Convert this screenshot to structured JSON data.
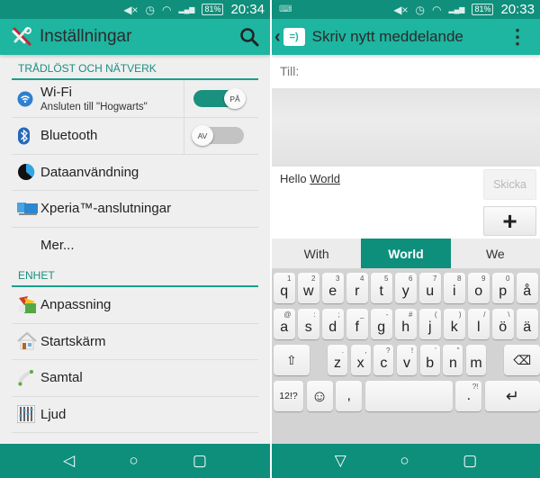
{
  "left": {
    "status": {
      "mute": "◀×",
      "alarm": "◷",
      "wifi": "◠",
      "signal": "▂▄▆",
      "battery": "81%",
      "time": "20:34"
    },
    "actionbar": {
      "icon": "wrench-screwdriver-icon",
      "title": "Inställningar",
      "search_icon": "⌕"
    },
    "sections": [
      {
        "header": "TRÅDLÖST OCH NÄTVERK",
        "items": [
          {
            "label": "Wi-Fi",
            "sub": "Ansluten till \"Hogwarts\"",
            "toggle": "PÅ",
            "toggle_on": true
          },
          {
            "label": "Bluetooth",
            "toggle": "AV",
            "toggle_on": false
          },
          {
            "label": "Dataanvändning"
          },
          {
            "label": "Xperia™-anslutningar"
          },
          {
            "label": "Mer..."
          }
        ]
      },
      {
        "header": "ENHET",
        "items": [
          {
            "label": "Anpassning"
          },
          {
            "label": "Startskärm"
          },
          {
            "label": "Samtal"
          },
          {
            "label": "Ljud"
          }
        ]
      }
    ],
    "nav": {
      "back": "◁",
      "home": "○",
      "recents": "▢"
    }
  },
  "right": {
    "status": {
      "keyboard_icon": "⌨",
      "mute": "◀×",
      "alarm": "◷",
      "wifi": "◠",
      "signal": "▂▄▆",
      "battery": "81%",
      "time": "20:33"
    },
    "actionbar": {
      "back": "‹",
      "app_icon": "=)",
      "title": "Skriv nytt meddelande",
      "menu": "⋮"
    },
    "to_label": "Till:",
    "message": {
      "before": "Hello ",
      "underlined": "World"
    },
    "send_label": "Skicka",
    "attach_label": "+",
    "suggestions": [
      {
        "text": "With",
        "active": false
      },
      {
        "text": "World",
        "active": true
      },
      {
        "text": "We",
        "active": false
      }
    ],
    "keyboard": {
      "row1": [
        {
          "k": "q",
          "a": "1"
        },
        {
          "k": "w",
          "a": "2"
        },
        {
          "k": "e",
          "a": "3"
        },
        {
          "k": "r",
          "a": "4"
        },
        {
          "k": "t",
          "a": "5"
        },
        {
          "k": "y",
          "a": "6"
        },
        {
          "k": "u",
          "a": "7"
        },
        {
          "k": "i",
          "a": "8"
        },
        {
          "k": "o",
          "a": "9"
        },
        {
          "k": "p",
          "a": "0"
        },
        {
          "k": "å",
          "a": ""
        }
      ],
      "row2": [
        {
          "k": "a",
          "a": "@"
        },
        {
          "k": "s",
          "a": ":"
        },
        {
          "k": "d",
          "a": ";"
        },
        {
          "k": "f",
          "a": "_"
        },
        {
          "k": "g",
          "a": "-"
        },
        {
          "k": "h",
          "a": "#"
        },
        {
          "k": "j",
          "a": "("
        },
        {
          "k": "k",
          "a": ")"
        },
        {
          "k": "l",
          "a": "/"
        },
        {
          "k": "ö",
          "a": "\\"
        },
        {
          "k": "ä",
          "a": ""
        }
      ],
      "row3": [
        {
          "k": "z",
          "a": "."
        },
        {
          "k": "x",
          "a": ","
        },
        {
          "k": "c",
          "a": "?"
        },
        {
          "k": "v",
          "a": "!"
        },
        {
          "k": "b",
          "a": "'"
        },
        {
          "k": "n",
          "a": "\""
        },
        {
          "k": "m",
          "a": ""
        }
      ],
      "shift": "⇧",
      "backspace": "⌫",
      "num": "12!?",
      "emoji": "☺",
      "comma": ",",
      "period": ".",
      "period_alt": "?!",
      "enter": "↵"
    },
    "nav": {
      "back": "▽",
      "home": "○",
      "recents": "▢"
    }
  }
}
